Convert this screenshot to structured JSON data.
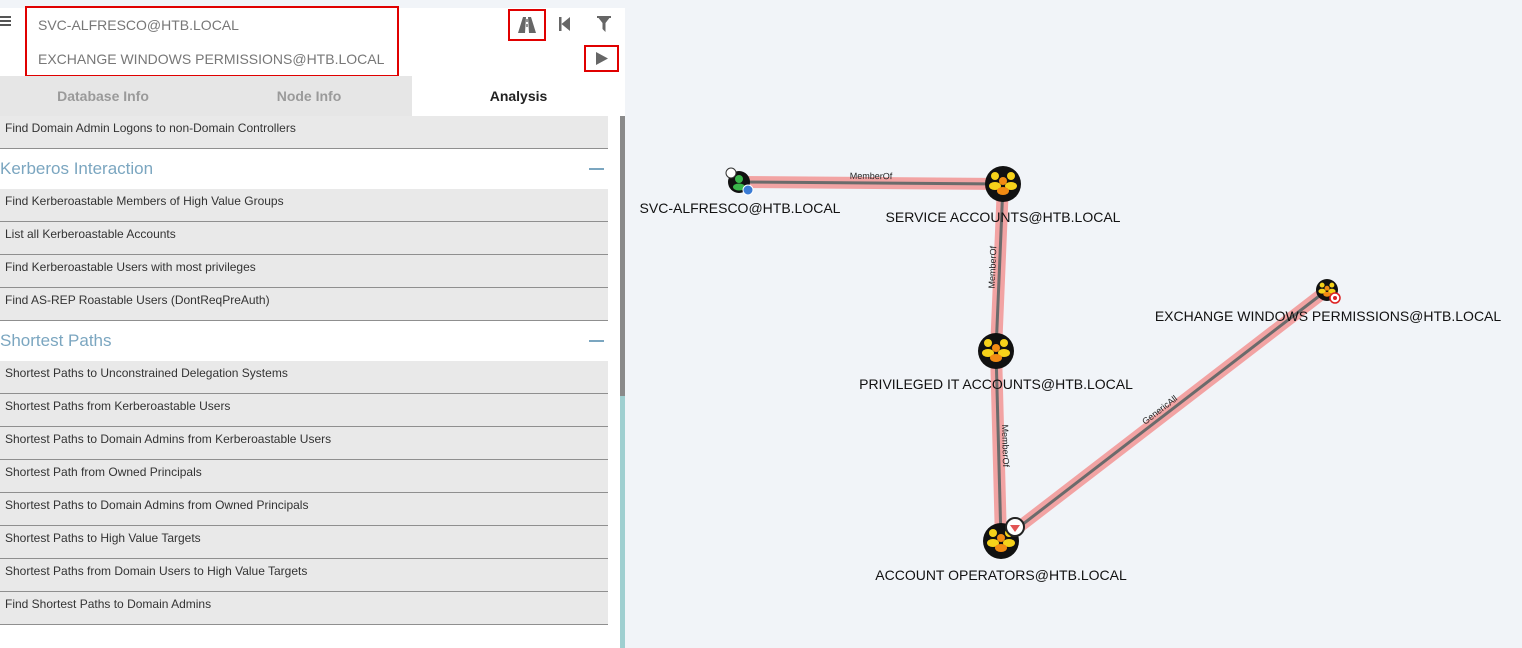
{
  "search": {
    "start_node": "SVC-ALFRESCO@HTB.LOCAL",
    "target_node": "EXCHANGE WINDOWS PERMISSIONS@HTB.LOCAL"
  },
  "tabs": [
    "Database Info",
    "Node Info",
    "Analysis"
  ],
  "active_tab": "Analysis",
  "analysis": {
    "top_query": "Find Domain Admin Logons to non-Domain Controllers",
    "sections": [
      {
        "title": "Kerberos Interaction",
        "queries": [
          "Find Kerberoastable Members of High Value Groups",
          "List all Kerberoastable Accounts",
          "Find Kerberoastable Users with most privileges",
          "Find AS-REP Roastable Users (DontReqPreAuth)"
        ]
      },
      {
        "title": "Shortest Paths",
        "queries": [
          "Shortest Paths to Unconstrained Delegation Systems",
          "Shortest Paths from Kerberoastable Users",
          "Shortest Paths to Domain Admins from Kerberoastable Users",
          "Shortest Path from Owned Principals",
          "Shortest Paths to Domain Admins from Owned Principals",
          "Shortest Paths to High Value Targets",
          "Shortest Paths from Domain Users to High Value Targets",
          "Find Shortest Paths to Domain Admins"
        ]
      }
    ]
  },
  "graph": {
    "nodes": [
      {
        "id": "svc",
        "label": "SVC-ALFRESCO@HTB.LOCAL",
        "type": "user"
      },
      {
        "id": "sa",
        "label": "SERVICE ACCOUNTS@HTB.LOCAL",
        "type": "group"
      },
      {
        "id": "pit",
        "label": "PRIVILEGED IT ACCOUNTS@HTB.LOCAL",
        "type": "group"
      },
      {
        "id": "ao",
        "label": "ACCOUNT OPERATORS@HTB.LOCAL",
        "type": "group"
      },
      {
        "id": "ewp",
        "label": "EXCHANGE WINDOWS PERMISSIONS@HTB.LOCAL",
        "type": "group"
      }
    ],
    "edges": [
      {
        "from": "svc",
        "to": "sa",
        "label": "MemberOf"
      },
      {
        "from": "sa",
        "to": "pit",
        "label": "MemberOf"
      },
      {
        "from": "pit",
        "to": "ao",
        "label": "MemberOf"
      },
      {
        "from": "ao",
        "to": "ewp",
        "label": "GenericAll"
      }
    ]
  },
  "colors": {
    "highlight": "#e00000",
    "path": "#f2a3a3",
    "edge": "#6b6b6b",
    "section_title": "#7ba6c0"
  }
}
